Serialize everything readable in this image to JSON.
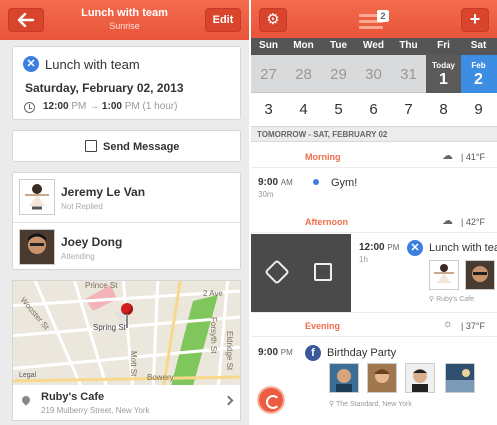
{
  "left": {
    "header": {
      "title": "Lunch with team",
      "subtitle": "Sunrise",
      "edit_label": "Edit"
    },
    "event": {
      "name": "Lunch with team",
      "date": "Saturday, February 02, 2013",
      "start_time": "12:00",
      "start_ampm": "PM",
      "arrow": "→",
      "end_time": "1:00",
      "end_ampm": "PM",
      "duration": "(1 hour)"
    },
    "send_message_label": "Send Message",
    "attendees": [
      {
        "name": "Jeremy Le Van",
        "status": "Not Replied"
      },
      {
        "name": "Joey Dong",
        "status": "Attending"
      }
    ],
    "map_labels": {
      "prince": "Prince St",
      "wooster": "Wooster St",
      "spring": "Spring St",
      "ave2": "2 Ave",
      "mott": "Mott St",
      "bowery": "Bowery",
      "forsyth": "Forsyth St",
      "eldridge": "Eldridge St",
      "legal": "Legal"
    },
    "location": {
      "name": "Ruby's Cafe",
      "address": "219 Mulberry Street, New York"
    }
  },
  "right": {
    "header": {
      "badge": "2"
    },
    "weekdays": [
      "Sun",
      "Mon",
      "Tue",
      "Wed",
      "Thu",
      "Fri",
      "Sat"
    ],
    "week1": [
      "27",
      "28",
      "29",
      "30",
      "31"
    ],
    "today": {
      "label": "Today",
      "day": "1"
    },
    "selected": {
      "label": "Feb",
      "day": "2"
    },
    "week2": [
      "3",
      "4",
      "5",
      "6",
      "7",
      "8",
      "9"
    ],
    "agenda_header": "TOMORROW - SAT, FEBRUARY 02",
    "morning": {
      "label": "Morning",
      "temp": "41°F"
    },
    "gym": {
      "time": "9:00",
      "ampm": "AM",
      "duration": "30m",
      "title": "Gym!"
    },
    "afternoon": {
      "label": "Afternoon",
      "temp": "42°F"
    },
    "lunch": {
      "time": "12:00",
      "ampm": "PM",
      "duration": "1h",
      "title": "Lunch with team",
      "location": "Ruby's Cafe"
    },
    "evening": {
      "label": "Evening",
      "temp": "37°F"
    },
    "party": {
      "time": "9:00",
      "ampm": "PM",
      "title": "Birthday Party",
      "location": "The Standard, New York"
    }
  },
  "colors": {
    "accent": "#ee6d4c",
    "header": "#e8543a",
    "selected": "#3d8de3",
    "today": "#5a5a5a"
  }
}
